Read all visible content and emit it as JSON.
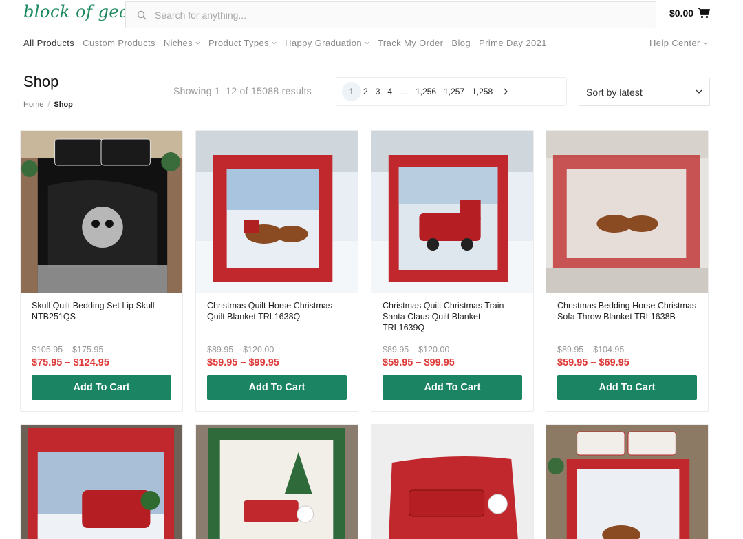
{
  "header": {
    "logo_text": "block of gear",
    "search_placeholder": "Search for anything...",
    "cart_total": "$0.00",
    "brand_color": "#1e8a5f"
  },
  "nav": {
    "items": [
      "All Products",
      "Custom Products",
      "Niches",
      "Product Types",
      "Happy Graduation",
      "Track My Order",
      "Blog",
      "Prime Day 2021"
    ],
    "help": "Help Center"
  },
  "shop": {
    "title": "Shop",
    "breadcrumb_home": "Home",
    "breadcrumb_sep": "/",
    "breadcrumb_current": "Shop",
    "results": "Showing 1–12 of 15088 results",
    "pages": [
      "1",
      "2",
      "3",
      "4",
      "…",
      "1,256",
      "1,257",
      "1,258"
    ],
    "sort_label": "Sort by latest"
  },
  "products": [
    {
      "name": "Skull Quilt Bedding Set Lip Skull NTB251QS",
      "old_price": "$105.95 – $175.95",
      "price": "$75.95 – $124.95",
      "button": "Add To Cart"
    },
    {
      "name": "Christmas Quilt Horse Christmas Quilt Blanket TRL1638Q",
      "old_price": "$89.95 – $120.00",
      "price": "$59.95 – $99.95",
      "button": "Add To Cart"
    },
    {
      "name": "Christmas Quilt Christmas Train Santa Claus Quilt Blanket TRL1639Q",
      "old_price": "$89.95 – $120.00",
      "price": "$59.95 – $99.95",
      "button": "Add To Cart"
    },
    {
      "name": "Christmas Bedding Horse Christmas Sofa Throw Blanket TRL1638B",
      "old_price": "$89.95 – $104.95",
      "price": "$59.95 – $69.95",
      "button": "Add To Cart"
    }
  ],
  "colors": {
    "button": "#1a8463",
    "sale_price": "#e03b3b"
  }
}
